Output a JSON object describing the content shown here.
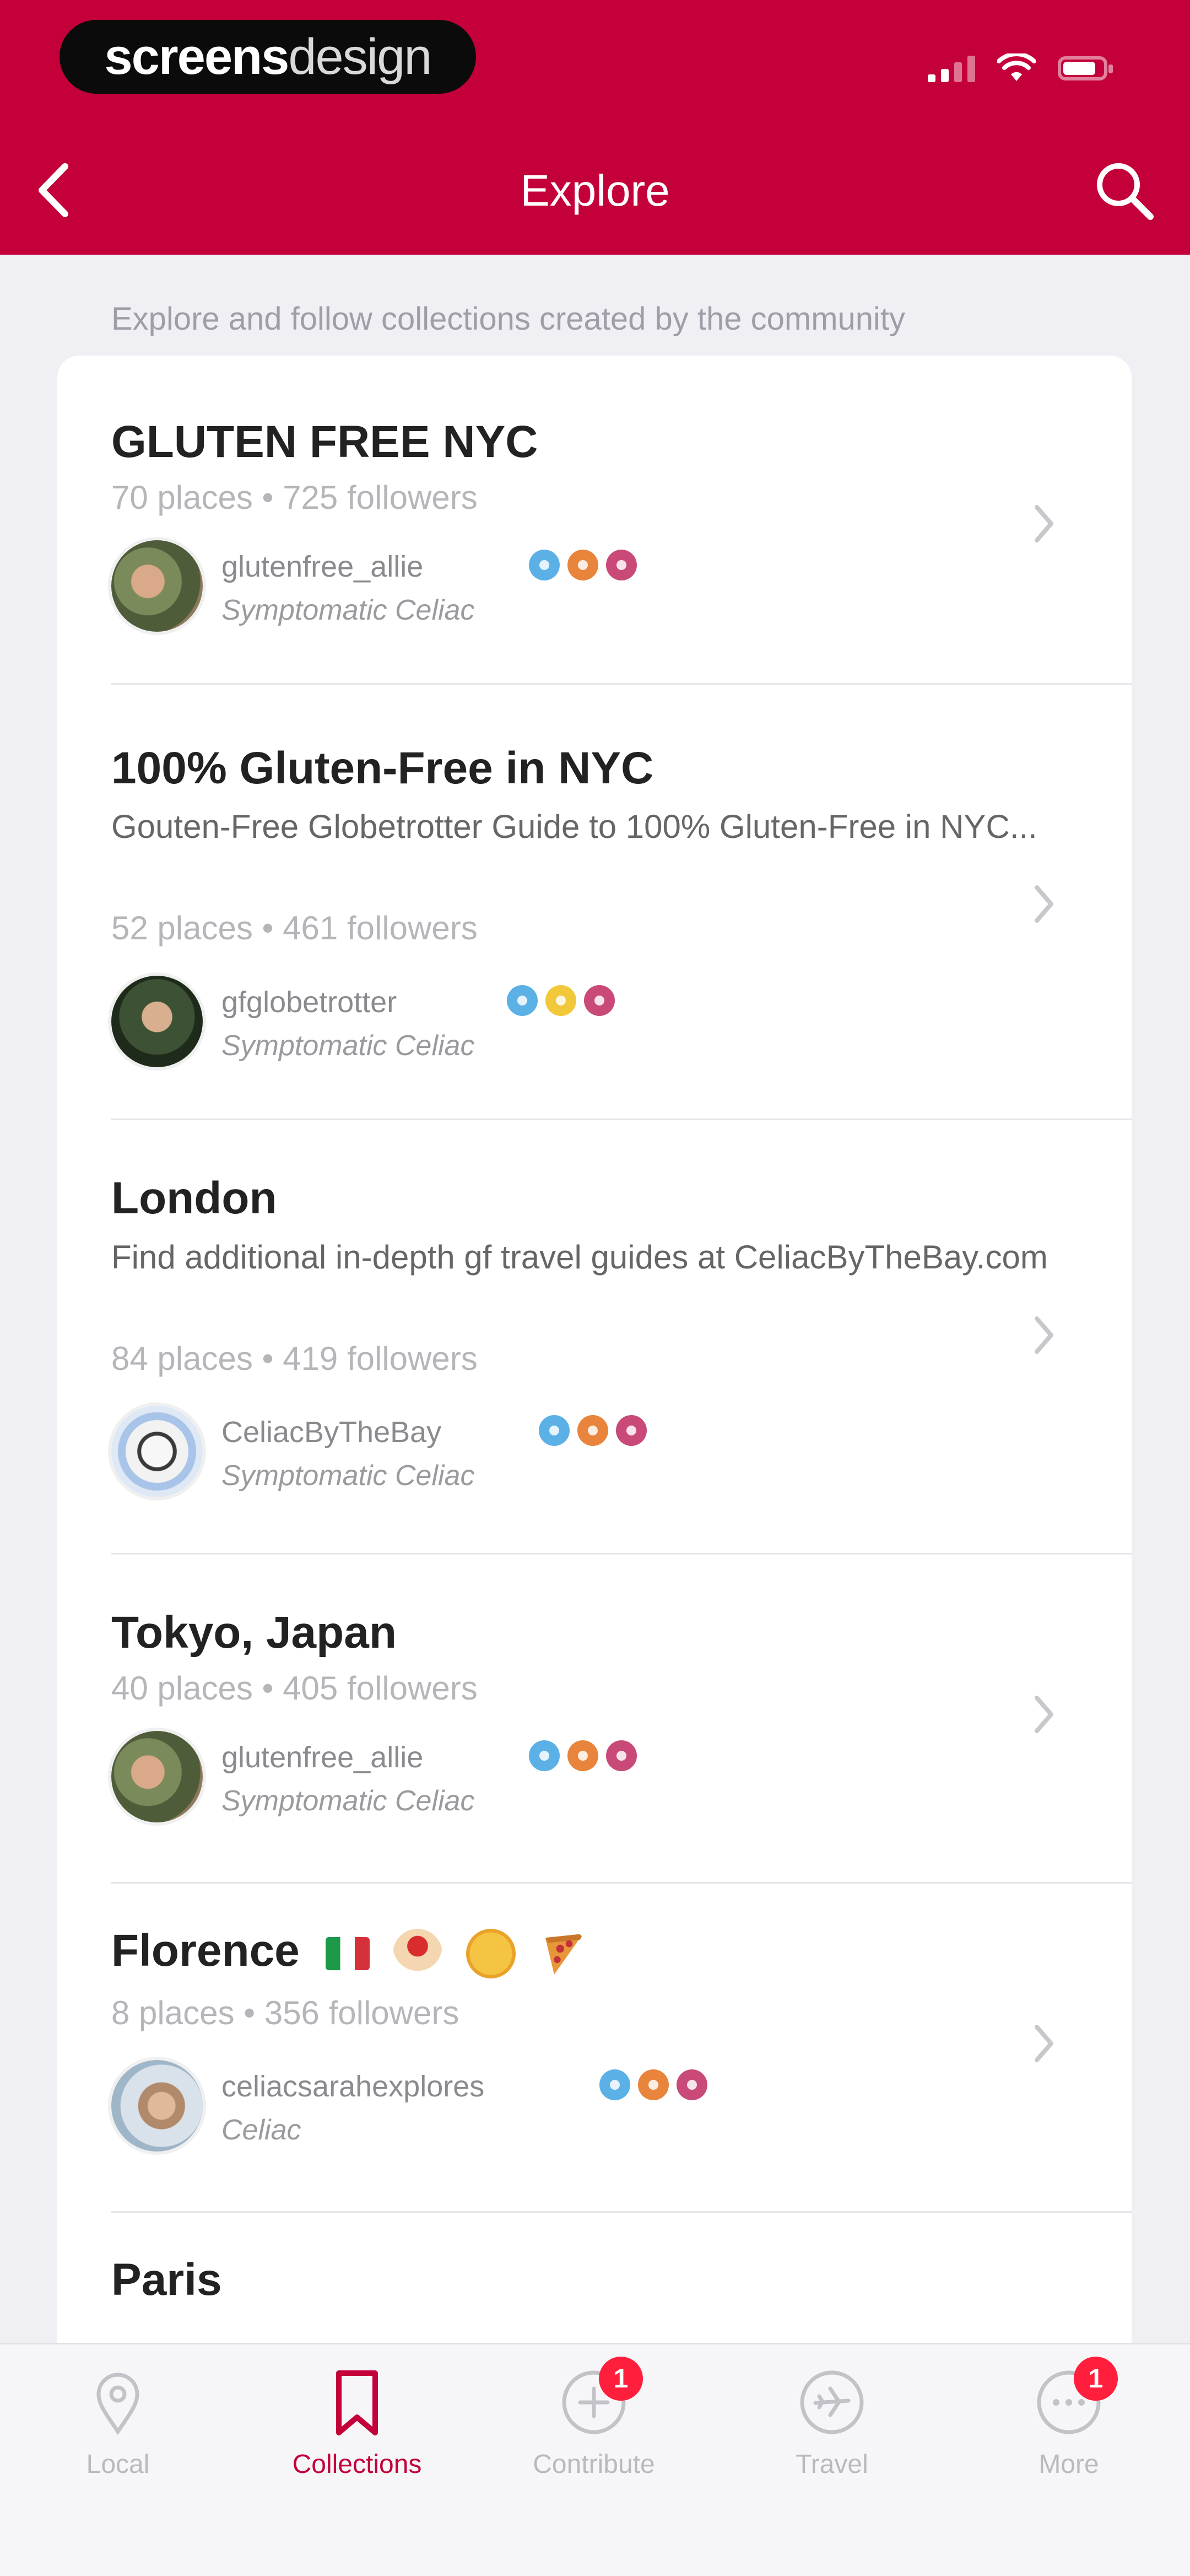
{
  "status_bar": {
    "brand_bold": "screens",
    "brand_light": "design"
  },
  "header": {
    "title": "Explore"
  },
  "subtitle": "Explore and follow collections created by the community",
  "collections": [
    {
      "title": "GLUTEN FREE NYC",
      "description": "",
      "meta": "70 places • 725 followers",
      "user": {
        "name": "glutenfree_allie",
        "role": "Symptomatic Celiac"
      },
      "badges": [
        "blue",
        "orange",
        "pink"
      ]
    },
    {
      "title": "100% Gluten-Free in NYC",
      "description": "Gouten-Free Globetrotter Guide to 100% Gluten-Free in NYC...",
      "meta": "52 places • 461 followers",
      "user": {
        "name": "gfglobetrotter",
        "role": "Symptomatic Celiac"
      },
      "badges": [
        "blue",
        "yellow",
        "pink"
      ]
    },
    {
      "title": "London",
      "description": "Find additional in-depth gf travel guides at CeliacByTheBay.com",
      "meta": "84 places • 419 followers",
      "user": {
        "name": "CeliacByTheBay",
        "role": "Symptomatic Celiac"
      },
      "badges": [
        "blue",
        "orange",
        "pink"
      ]
    },
    {
      "title": "Tokyo, Japan",
      "description": "",
      "meta": "40 places • 405 followers",
      "user": {
        "name": "glutenfree_allie",
        "role": "Symptomatic Celiac"
      },
      "badges": [
        "blue",
        "orange",
        "pink"
      ]
    },
    {
      "title": "Florence",
      "description": "",
      "meta": "8 places • 356 followers",
      "user": {
        "name": "celiacsarahexplores",
        "role": "Celiac"
      },
      "badges": [
        "blue",
        "orange",
        "pink"
      ]
    },
    {
      "title": "Paris",
      "description": "",
      "meta": "",
      "user": {
        "name": "",
        "role": ""
      },
      "badges": []
    }
  ],
  "tabbar": {
    "local": "Local",
    "collections": "Collections",
    "contribute": "Contribute",
    "contribute_badge": "1",
    "travel": "Travel",
    "more": "More",
    "more_badge": "1"
  },
  "colors": {
    "brand": "#c4003a",
    "badge_red": "#ff1f3d"
  }
}
